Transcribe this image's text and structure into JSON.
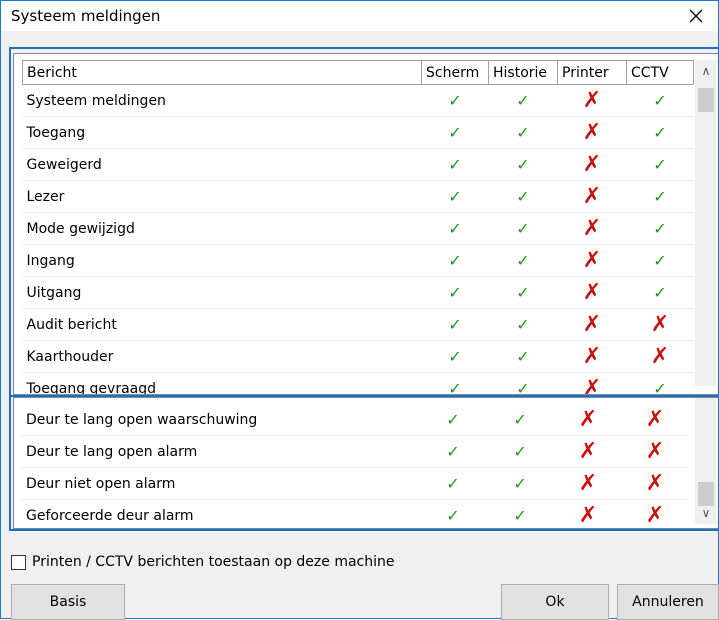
{
  "window": {
    "title": "Systeem meldingen",
    "close": "×"
  },
  "columns": [
    "Bericht",
    "Scherm",
    "Historie",
    "Printer",
    "CCTV"
  ],
  "rows1": [
    {
      "name": "Systeem meldingen",
      "scherm": "✓",
      "historie": "✓",
      "printer": "✗",
      "cctv": "✓"
    },
    {
      "name": "Toegang",
      "scherm": "✓",
      "historie": "✓",
      "printer": "✗",
      "cctv": "✓"
    },
    {
      "name": "Geweigerd",
      "scherm": "✓",
      "historie": "✓",
      "printer": "✗",
      "cctv": "✓"
    },
    {
      "name": "Lezer",
      "scherm": "✓",
      "historie": "✓",
      "printer": "✗",
      "cctv": "✓"
    },
    {
      "name": "Mode gewijzigd",
      "scherm": "✓",
      "historie": "✓",
      "printer": "✗",
      "cctv": "✓"
    },
    {
      "name": "Ingang",
      "scherm": "✓",
      "historie": "✓",
      "printer": "✗",
      "cctv": "✓"
    },
    {
      "name": "Uitgang",
      "scherm": "✓",
      "historie": "✓",
      "printer": "✗",
      "cctv": "✓"
    },
    {
      "name": "Audit bericht",
      "scherm": "✓",
      "historie": "✓",
      "printer": "✗",
      "cctv": "✗"
    },
    {
      "name": "Kaarthouder",
      "scherm": "✓",
      "historie": "✓",
      "printer": "✗",
      "cctv": "✗"
    },
    {
      "name": "Toegang gevraagd",
      "scherm": "✓",
      "historie": "✓",
      "printer": "✗",
      "cctv": "✓"
    }
  ],
  "rows2": [
    {
      "name": "Deur te lang open waarschuwing",
      "scherm": "✓",
      "historie": "✓",
      "printer": "✗",
      "cctv": "✗"
    },
    {
      "name": "Deur te lang open alarm",
      "scherm": "✓",
      "historie": "✓",
      "printer": "✗",
      "cctv": "✗"
    },
    {
      "name": "Deur niet open alarm",
      "scherm": "✓",
      "historie": "✓",
      "printer": "✗",
      "cctv": "✗"
    },
    {
      "name": "Geforceerde deur alarm",
      "scherm": "✓",
      "historie": "✓",
      "printer": "✗",
      "cctv": "✗"
    }
  ],
  "option": {
    "label": "Printen / CCTV berichten toestaan op deze machine"
  },
  "buttons": {
    "basis": "Basis",
    "ok": "Ok",
    "cancel": "Annuleren"
  },
  "scroll": {
    "up": "∧",
    "down": "∨"
  }
}
